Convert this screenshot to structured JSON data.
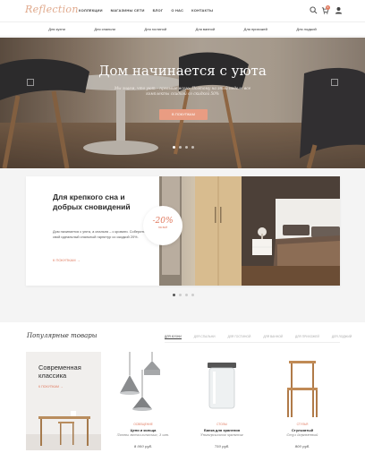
{
  "header": {
    "logo": "Reflection",
    "nav": [
      "КОЛЛЕКЦИИ",
      "МАГАЗИНЫ СЕТИ",
      "БЛОГ",
      "О НАС",
      "КОНТАКТЫ"
    ],
    "cart_count": "0",
    "icons": [
      "search-icon",
      "cart-icon",
      "user-icon"
    ]
  },
  "categories": [
    "Для кухни",
    "Для спальни",
    "Для гостиной",
    "Для ванной",
    "Для прихожей",
    "Для лоджий"
  ],
  "hero": {
    "title": "Дом начинается с уюта",
    "subtitle": "Мы знаем, что уют – превыше всего. Поэтому на этой неделе все комплекты скидкой со скидкой 50%",
    "button": "В ПОКУПКАМ",
    "slides": 4,
    "active_slide": 1
  },
  "promo": {
    "title": "Для крепкого сна и добрых сновидений",
    "text": "Дом начинается с уюта, а спальня – с кровати. Соберите свой идеальный спальный гарнитур со скидкой 20%.",
    "link": "К ПОКУПКАМ",
    "discount": "-20%",
    "discount_caption": "на всё",
    "slides": 4,
    "active_slide": 1
  },
  "popular": {
    "title": "Популярные товары",
    "tabs": [
      "ДЛЯ КУХНИ",
      "ДЛЯ СПАЛЬНИ",
      "ДЛЯ ГОСТИНОЙ",
      "ДЛЯ ВАННОЙ",
      "ДЛЯ ПРИХОЖЕЙ",
      "ДЛЯ ЛОДЖИЙ"
    ],
    "active_tab": 0,
    "feature": {
      "title": "Современная классика",
      "link": "К ПОКУПКАМ"
    },
    "products": [
      {
        "category": "ОСВЕЩЕНИЕ",
        "name": "Цепи и кольца",
        "desc": "Лампы металлические, 3 шт.",
        "price": "8 000 руб."
      },
      {
        "category": "СТОЛЫ",
        "name": "Банка для хранения",
        "desc": "Универсальное хранение",
        "price": "750 руб."
      },
      {
        "category": "СТУЛЬЯ",
        "name": "Стульчатый",
        "desc": "Стул деревянный",
        "price": "800 руб."
      }
    ]
  },
  "colors": {
    "accent": "#e07a5f",
    "button": "#e99c82",
    "logo": "#e0a98c"
  }
}
